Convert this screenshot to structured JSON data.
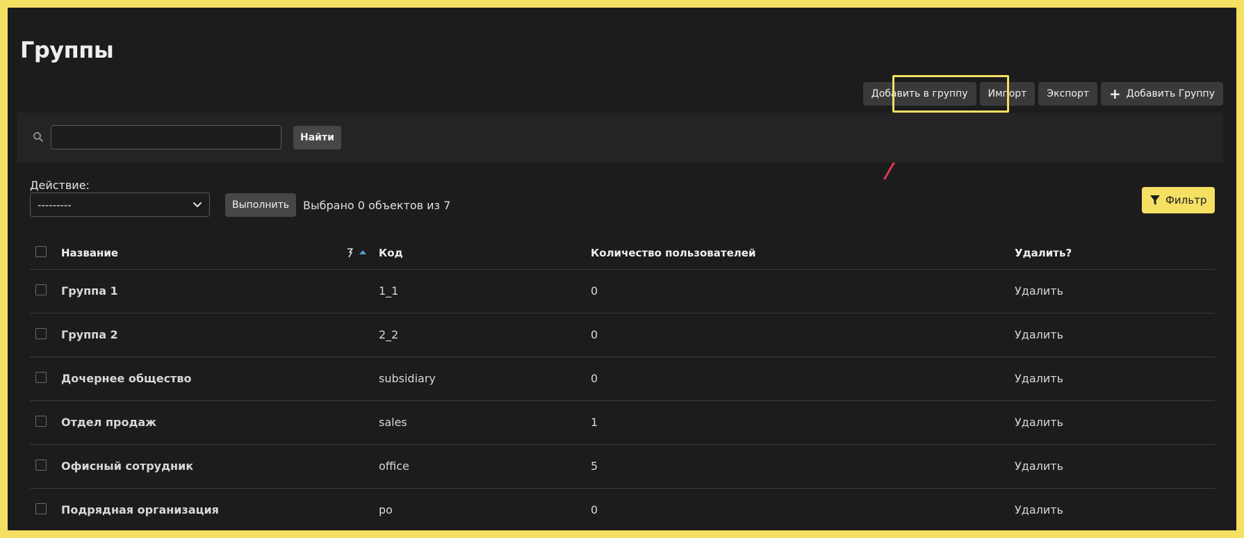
{
  "page": {
    "title": "Группы"
  },
  "toolbar": {
    "add_to_group": "Добавить в группу",
    "import": "Импорт",
    "export": "Экспорт",
    "add_group": "Добавить Группу"
  },
  "search": {
    "value": "",
    "button": "Найти",
    "icon": "search-icon"
  },
  "actions": {
    "label": "Действие:",
    "select_value": "---------",
    "run_button": "Выполнить",
    "selected_text": "Выбрано 0 объектов из 7"
  },
  "filter": {
    "label": "Фильтр",
    "icon": "funnel-icon"
  },
  "table": {
    "headers": {
      "name": "Название",
      "code": "Код",
      "user_count": "Количество пользователей",
      "delete": "Удалить?"
    },
    "rows": [
      {
        "name": "Группа 1",
        "code": "1_1",
        "count": "0",
        "delete": "Удалить"
      },
      {
        "name": "Группа 2",
        "code": "2_2",
        "count": "0",
        "delete": "Удалить"
      },
      {
        "name": "Дочернее общество",
        "code": "subsidiary",
        "count": "0",
        "delete": "Удалить"
      },
      {
        "name": "Отдел продаж",
        "code": "sales",
        "count": "1",
        "delete": "Удалить"
      },
      {
        "name": "Офисный сотрудник",
        "code": "office",
        "count": "5",
        "delete": "Удалить"
      },
      {
        "name": "Подрядная организация",
        "code": "po",
        "count": "0",
        "delete": "Удалить"
      }
    ]
  },
  "colors": {
    "background": "#1c1c1c",
    "highlight": "#f5e064",
    "arrow": "#e0385a",
    "button": "#3a3a3a"
  }
}
